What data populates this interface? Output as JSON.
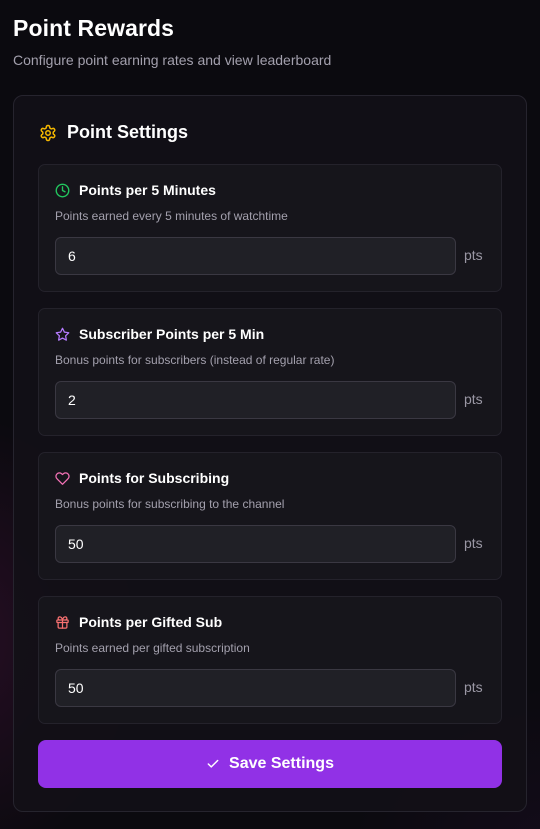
{
  "header": {
    "title": "Point Rewards",
    "subtitle": "Configure point earning rates and view leaderboard"
  },
  "panel": {
    "title": "Point Settings",
    "icon": "gear-icon",
    "icon_color": "#f5b800"
  },
  "settings": [
    {
      "title": "Points per 5 Minutes",
      "description": "Points earned every 5 minutes of watchtime",
      "value": "6",
      "unit": "pts",
      "icon": "clock-icon",
      "icon_color": "#22c55e"
    },
    {
      "title": "Subscriber Points per 5 Min",
      "description": "Bonus points for subscribers (instead of regular rate)",
      "value": "2",
      "unit": "pts",
      "icon": "star-icon",
      "icon_color": "#b57bff"
    },
    {
      "title": "Points for Subscribing",
      "description": "Bonus points for subscribing to the channel",
      "value": "50",
      "unit": "pts",
      "icon": "heart-icon",
      "icon_color": "#f472b6"
    },
    {
      "title": "Points per Gifted Sub",
      "description": "Points earned per gifted subscription",
      "value": "50",
      "unit": "pts",
      "icon": "gift-icon",
      "icon_color": "#f87171"
    }
  ],
  "save_button": {
    "label": "Save Settings",
    "icon": "check-icon",
    "color": "#9131e6"
  }
}
